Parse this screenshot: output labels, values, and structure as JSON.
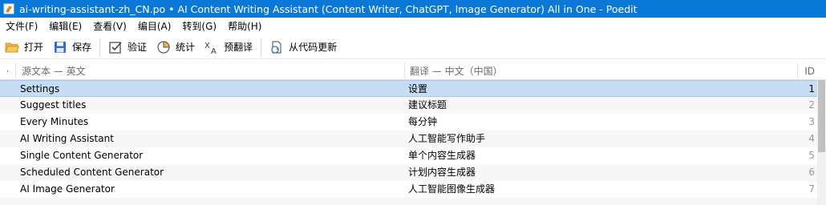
{
  "window": {
    "title": "ai-writing-assistant-zh_CN.po • AI Content Writing Assistant (Content Writer, ChatGPT, Image Generator) All in One - Poedit",
    "icon": "poedit-icon"
  },
  "menu": {
    "file": "文件(F)",
    "edit": "编辑(E)",
    "view": "查看(V)",
    "catalog": "编目(A)",
    "goto": "转到(G)",
    "help": "帮助(H)"
  },
  "toolbar": {
    "open": "打开",
    "save": "保存",
    "validate": "验证",
    "statistics": "统计",
    "pretranslate": "预翻译",
    "update_from_code": "从代码更新"
  },
  "list": {
    "header": {
      "marker": "·",
      "source": "源文本 — 英文",
      "translation": "翻译 — 中文（中国）",
      "id": "ID"
    },
    "rows": [
      {
        "source": "Settings",
        "translation": "设置",
        "id": "1",
        "selected": true
      },
      {
        "source": "Suggest titles",
        "translation": "建议标题",
        "id": "2"
      },
      {
        "source": "Every Minutes",
        "translation": "每分钟",
        "id": "3"
      },
      {
        "source": "AI Writing Assistant",
        "translation": "人工智能写作助手",
        "id": "4"
      },
      {
        "source": "Single Content Generator",
        "translation": "单个内容生成器",
        "id": "5"
      },
      {
        "source": "Scheduled Content Generator",
        "translation": "计划内容生成器",
        "id": "6"
      },
      {
        "source": "AI Image Generator",
        "translation": "人工智能图像生成器",
        "id": "7"
      }
    ]
  },
  "colors": {
    "titlebar": "#0a78d7",
    "selection": "#c5ddf5",
    "alt_row": "#f7f7f7"
  }
}
